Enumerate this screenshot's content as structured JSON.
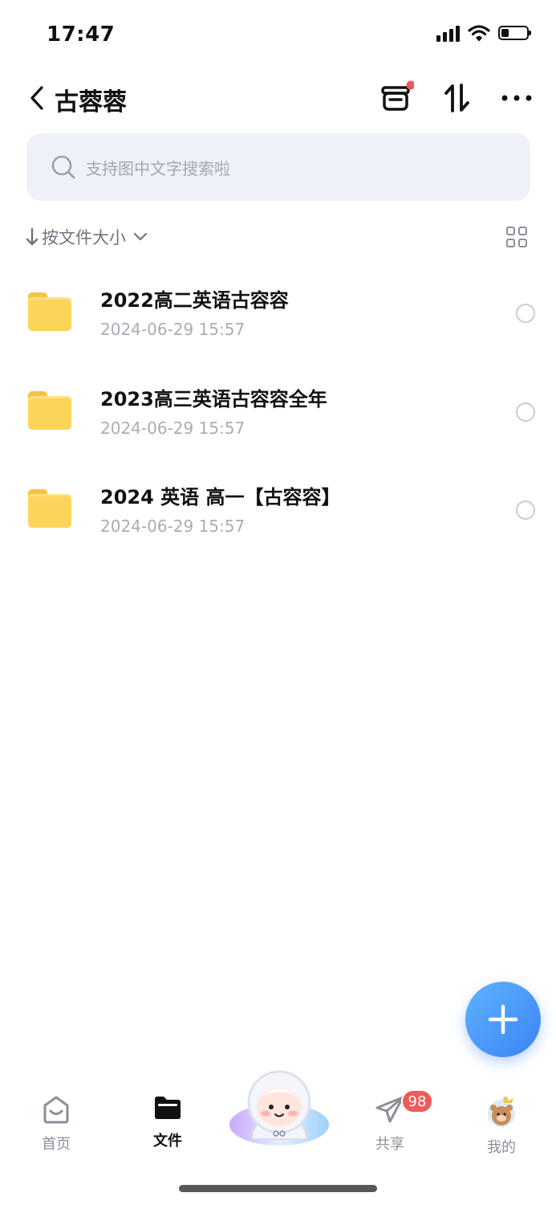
{
  "status_bar": {
    "time": "17:47"
  },
  "header": {
    "title": "古蓉蓉"
  },
  "search": {
    "placeholder": "支持图中文字搜索啦"
  },
  "sort": {
    "label": "按文件大小"
  },
  "files": [
    {
      "name": "2022高二英语古容容",
      "date": "2024-06-29 15:57"
    },
    {
      "name": "2023高三英语古容容全年",
      "date": "2024-06-29 15:57"
    },
    {
      "name": "2024 英语 高一【古容容】",
      "date": "2024-06-29 15:57"
    }
  ],
  "nav": {
    "home": "首页",
    "files": "文件",
    "share": "共享",
    "mine": "我的",
    "share_badge": "98"
  },
  "colors": {
    "accent": "#3a84f5",
    "folder": "#fbd45a",
    "badge": "#ef5a5a"
  }
}
